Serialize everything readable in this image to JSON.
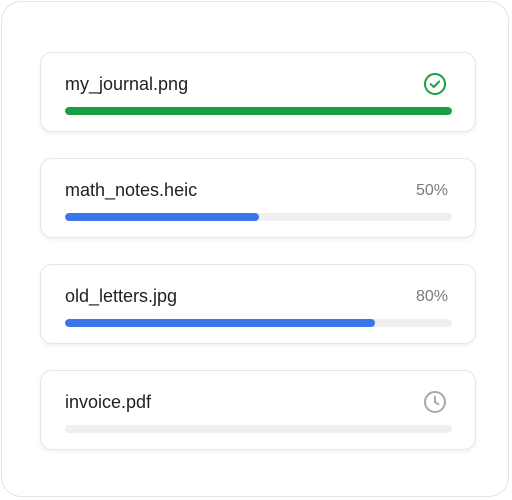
{
  "colors": {
    "complete": "#1a9e43",
    "in_progress": "#3b76e8",
    "pending": "#a8a8a8",
    "track": "#efefef"
  },
  "uploads": [
    {
      "file_name": "my_journal.png",
      "status": "complete",
      "progress": 1.0,
      "status_icon": "check-circle-icon"
    },
    {
      "file_name": "math_notes.heic",
      "status": "in_progress",
      "progress": 0.5,
      "percent_label": "50%"
    },
    {
      "file_name": "old_letters.jpg",
      "status": "in_progress",
      "progress": 0.8,
      "percent_label": "80%"
    },
    {
      "file_name": "invoice.pdf",
      "status": "pending",
      "progress": 0.0,
      "status_icon": "clock-icon"
    }
  ]
}
